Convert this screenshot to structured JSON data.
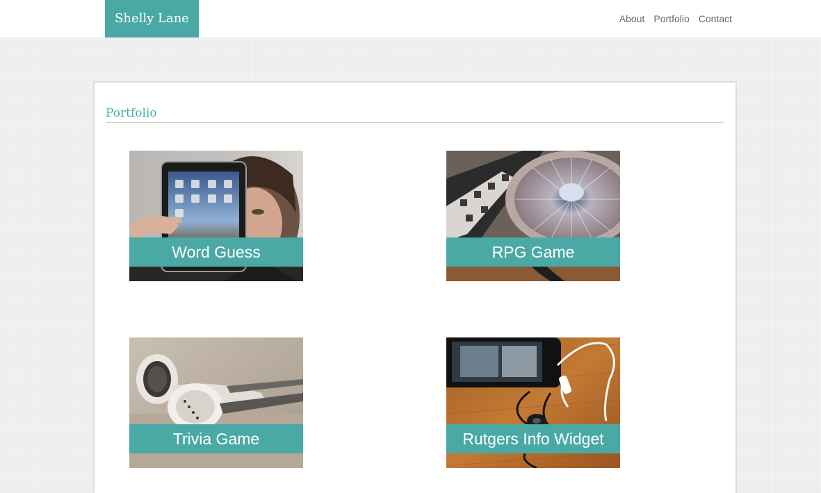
{
  "header": {
    "brand": "Shelly Lane",
    "brand_color": "#4aa9a5",
    "nav": [
      {
        "label": "About"
      },
      {
        "label": "Portfolio"
      },
      {
        "label": "Contact"
      }
    ]
  },
  "main": {
    "section_title": "Portfolio",
    "projects": [
      {
        "title": "Word Guess",
        "image": "person-holding-tablet-photo"
      },
      {
        "title": "RPG Game",
        "image": "dj-turntable-photo"
      },
      {
        "title": "Trivia Game",
        "image": "earbuds-photo"
      },
      {
        "title": "Rutgers Info Widget",
        "image": "smartphone-with-earphones-photo"
      }
    ]
  }
}
